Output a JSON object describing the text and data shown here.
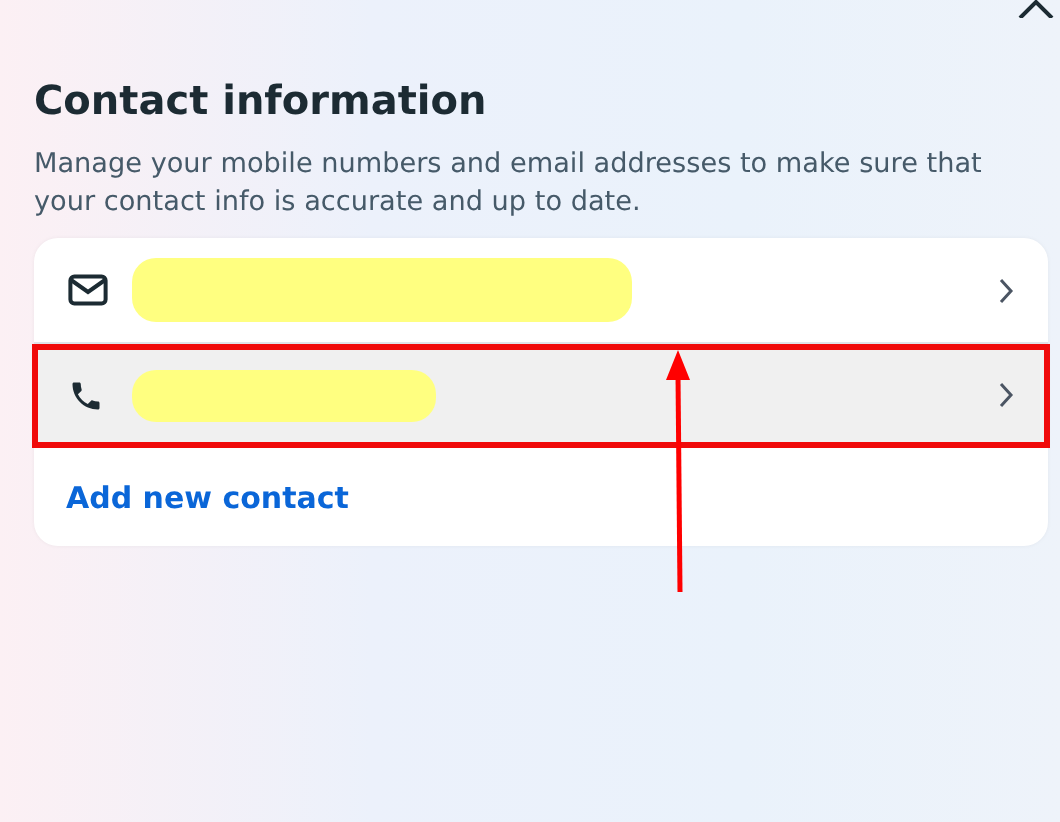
{
  "title": "Contact information",
  "description": "Manage your mobile numbers and email addresses to make sure that your contact info is accurate and up to date.",
  "contacts": [
    {
      "kind": "email",
      "selected": false,
      "annotated": false,
      "redacted": true
    },
    {
      "kind": "phone",
      "selected": true,
      "annotated": true,
      "redacted": true
    }
  ],
  "add_link": "Add new contact"
}
